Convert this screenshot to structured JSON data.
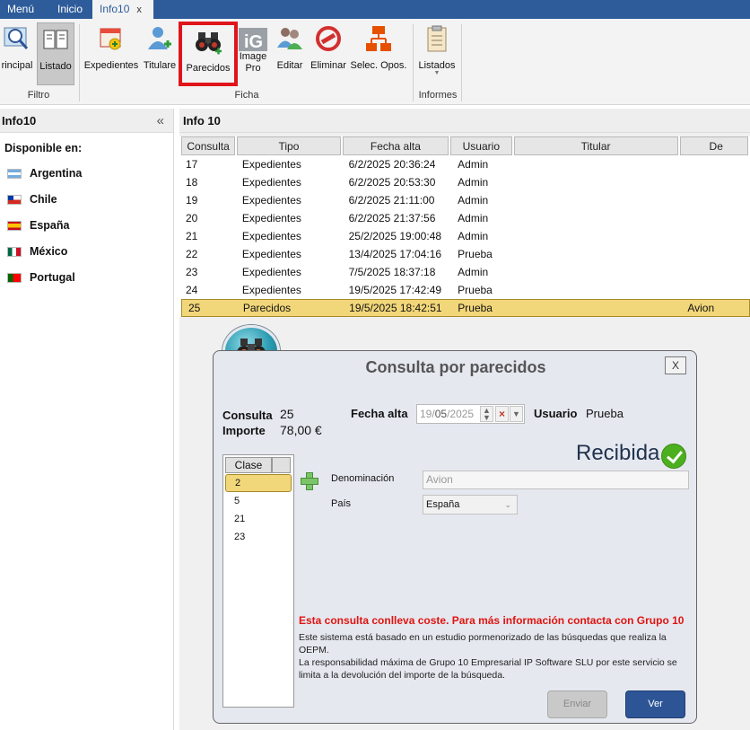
{
  "topbar": {
    "menu": "Menú",
    "inicio": "Inicio",
    "active_tab": "Info10",
    "close": "x"
  },
  "ribbon": {
    "buttons": {
      "principal": "rincipal",
      "listado": "Listado",
      "expedientes": "Expedientes",
      "titulares": "Titulare",
      "parecidos": "Parecidos",
      "image_pro_1": "Image",
      "image_pro_2": "Pro",
      "editar": "Editar",
      "eliminar": "Eliminar",
      "selec_opos": "Selec. Opos.",
      "listados": "Listados"
    },
    "groups": {
      "filtro": "Filtro",
      "ficha": "Ficha",
      "informes": "Informes"
    },
    "highlight_color": "#e0141b"
  },
  "left_panel": {
    "title": "Info10",
    "collapse": "«",
    "available_label": "Disponible en:",
    "countries": [
      "Argentina",
      "Chile",
      "España",
      "México",
      "Portugal"
    ]
  },
  "main": {
    "title": "Info 10",
    "columns": [
      "Consulta",
      "Tipo",
      "Fecha alta",
      "Usuario",
      "Titular",
      "De"
    ],
    "rows": [
      {
        "consulta": "17",
        "tipo": "Expedientes",
        "fecha": "6/2/2025 20:36:24",
        "usuario": "Admin",
        "titular": "",
        "de": ""
      },
      {
        "consulta": "18",
        "tipo": "Expedientes",
        "fecha": "6/2/2025 20:53:30",
        "usuario": "Admin",
        "titular": "",
        "de": ""
      },
      {
        "consulta": "19",
        "tipo": "Expedientes",
        "fecha": "6/2/2025 21:11:00",
        "usuario": "Admin",
        "titular": "",
        "de": ""
      },
      {
        "consulta": "20",
        "tipo": "Expedientes",
        "fecha": "6/2/2025 21:37:56",
        "usuario": "Admin",
        "titular": "",
        "de": ""
      },
      {
        "consulta": "21",
        "tipo": "Expedientes",
        "fecha": "25/2/2025 19:00:48",
        "usuario": "Admin",
        "titular": "",
        "de": ""
      },
      {
        "consulta": "22",
        "tipo": "Expedientes",
        "fecha": "13/4/2025 17:04:16",
        "usuario": "Prueba",
        "titular": "",
        "de": ""
      },
      {
        "consulta": "23",
        "tipo": "Expedientes",
        "fecha": "7/5/2025 18:37:18",
        "usuario": "Admin",
        "titular": "",
        "de": ""
      },
      {
        "consulta": "24",
        "tipo": "Expedientes",
        "fecha": "19/5/2025 17:42:49",
        "usuario": "Prueba",
        "titular": "",
        "de": ""
      },
      {
        "consulta": "25",
        "tipo": "Parecidos",
        "fecha": "19/5/2025 18:42:51",
        "usuario": "Prueba",
        "titular": "",
        "de": "Avion"
      }
    ],
    "selected_row_color": "#f2d77a"
  },
  "dialog": {
    "title": "Consulta por parecidos",
    "close": "X",
    "consulta_label": "Consulta",
    "consulta_value": "25",
    "importe_label": "Importe",
    "importe_value": "78,00 €",
    "fecha_label": "Fecha alta",
    "fecha_day": "19",
    "fecha_month": "05",
    "fecha_year": "2025",
    "usuario_label": "Usuario",
    "usuario_value": "Prueba",
    "status": "Recibida",
    "clase_header": "Clase",
    "clases": [
      "2",
      "5",
      "21",
      "23"
    ],
    "denominacion_label": "Denominación",
    "denominacion_value": "Avion",
    "pais_label": "País",
    "pais_value": "España",
    "warning": "Esta consulta conlleva coste. Para más información contacta con Grupo 10",
    "info_lines": [
      "Este sistema está basado en un estudio pormenorizado de las búsquedas que realiza la",
      "OEPM.",
      "La responsabilidad máxima de Grupo 10 Empresarial IP Software SLU por este servicio se",
      "limita a la devolución del importe de la búsqueda."
    ],
    "enviar": "Enviar",
    "ver": "Ver"
  }
}
